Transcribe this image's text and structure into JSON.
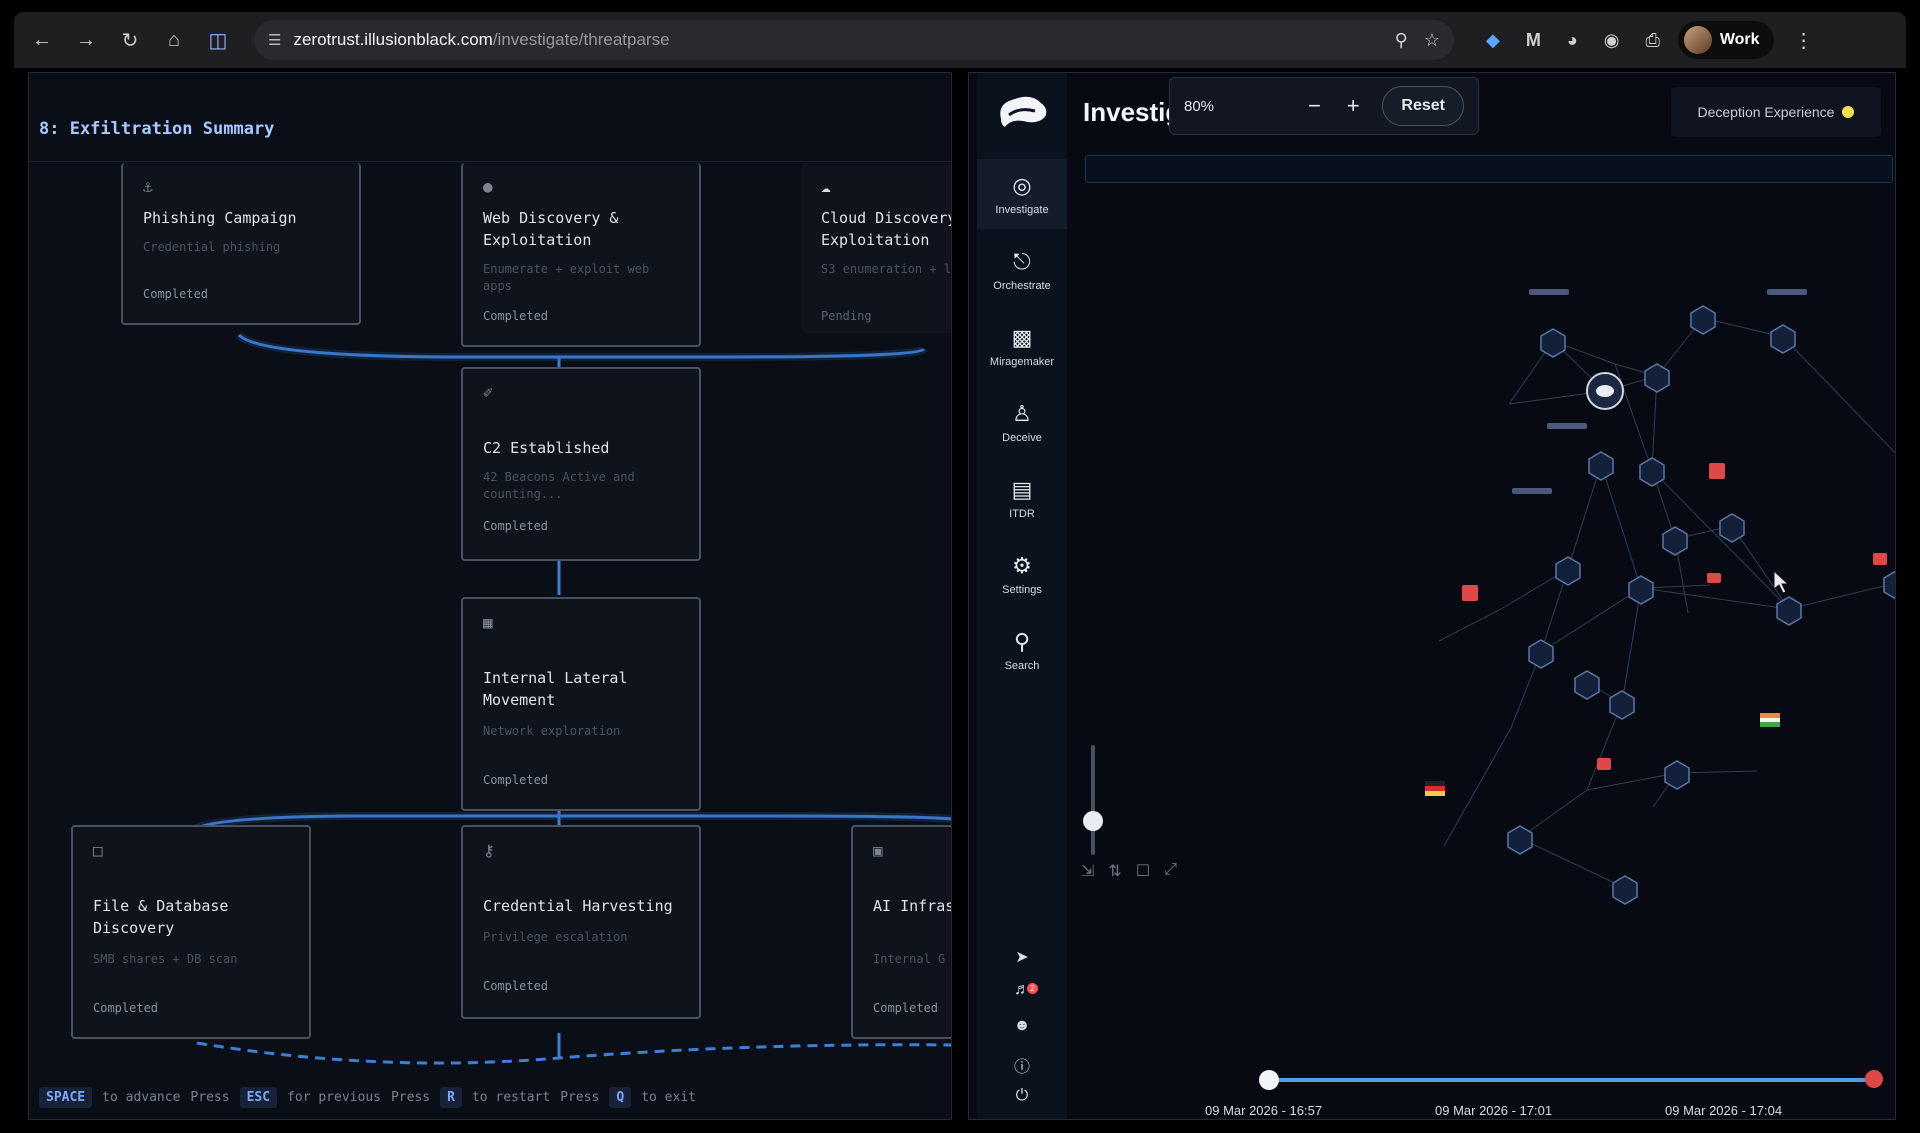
{
  "browser": {
    "url_host": "zerotrust.illusionblack.com",
    "url_path": "/investigate/threatparse",
    "profile_label": "Work"
  },
  "presentation": {
    "title": "8: Exfiltration Summary",
    "cards": [
      {
        "title": "Phishing Campaign",
        "desc": "Credential phishing",
        "status": "Completed"
      },
      {
        "title": "Web Discovery & Exploitation",
        "desc": "Enumerate + exploit web apps",
        "status": "Completed"
      },
      {
        "title": "Cloud Discovery Exploitation",
        "desc": "S3 enumeration + l",
        "status": "Pending"
      },
      {
        "title": "C2 Established",
        "desc": "42 Beacons Active and counting...",
        "status": "Completed"
      },
      {
        "title": "Internal Lateral Movement",
        "desc": "Network exploration",
        "status": "Completed"
      },
      {
        "title": "File & Database Discovery",
        "desc": "SMB shares + DB scan",
        "status": "Completed"
      },
      {
        "title": "Credential Harvesting",
        "desc": "Privilege escalation",
        "status": "Completed"
      },
      {
        "title": "AI Infras Discovery",
        "desc": "Internal G",
        "status": "Completed"
      }
    ],
    "footer": {
      "k1": "SPACE",
      "t1": "to advance",
      "p1": "Press",
      "k2": "ESC",
      "t2": "for previous",
      "p2": "Press",
      "k3": "R",
      "t3": "to restart",
      "p3": "Press",
      "k4": "Q",
      "t4": "to exit"
    }
  },
  "app": {
    "title": "Investig",
    "zoom": {
      "value": "80%",
      "reset_label": "Reset"
    },
    "deception_label": "Deception Experience",
    "nav": [
      {
        "label": "Investigate",
        "icon": "radar-icon"
      },
      {
        "label": "Orchestrate",
        "icon": "workflow-icon"
      },
      {
        "label": "Miragemaker",
        "icon": "cube-stack-icon"
      },
      {
        "label": "Deceive",
        "icon": "spy-icon"
      },
      {
        "label": "ITDR",
        "icon": "id-card-icon"
      },
      {
        "label": "Settings",
        "icon": "gear-icon"
      },
      {
        "label": "Search",
        "icon": "search-icon"
      }
    ],
    "notification_count": "2",
    "timeline": [
      "09 Mar 2026 - 16:57",
      "09 Mar 2026 - 17:01",
      "09 Mar 2026 - 17:04"
    ]
  },
  "colors": {
    "accent": "#4f9fe0",
    "alert": "#e04848",
    "status_dot": "#f4e04d"
  }
}
